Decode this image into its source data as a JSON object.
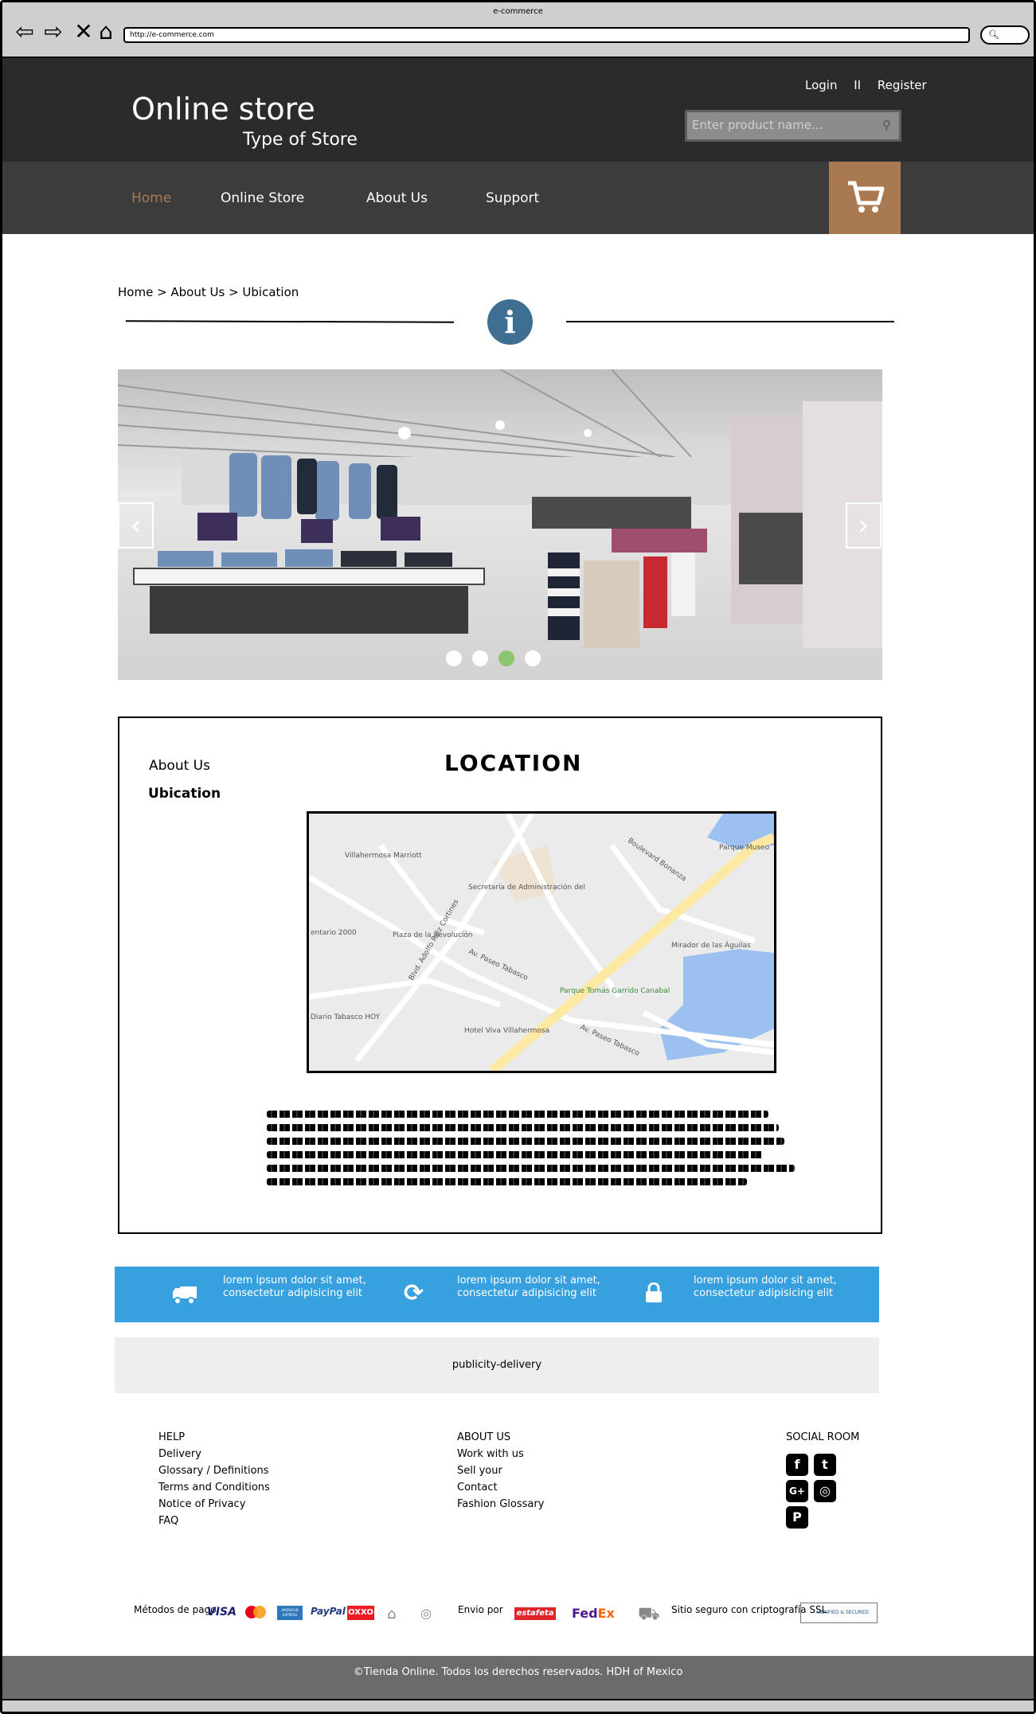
{
  "browser": {
    "window_title": "e-commerce",
    "url": "http://e-commerce.com"
  },
  "header": {
    "store_name": "Online store",
    "store_type": "Type of Store",
    "login": "Login",
    "separator": "II",
    "register": "Register",
    "search_placeholder": "Enter product name..."
  },
  "nav": {
    "items": [
      "Home",
      "Online Store",
      "About Us",
      "Support"
    ],
    "active": "Home"
  },
  "breadcrumb": "Home > About Us > Ubication",
  "carousel": {
    "dots": 4,
    "active_dot": 3
  },
  "location": {
    "side_items": [
      "About Us",
      "Ubication"
    ],
    "title": "LOCATION",
    "map_labels": [
      "Villahermosa Marriott",
      "Secretaría de Administración del",
      "Plaza de la Revolución",
      "Parque Tomás Garrido Canabal",
      "Hotel Viva Villahermosa",
      "Diario Tabasco HOY",
      "Mirador de las Águilas",
      "Parque Museo",
      "Av. Paseo Tabasco",
      "Blvd. Adolfo Ruiz Cortines",
      "Boulevard Bonanza",
      "Av. Paseo Tabasco",
      "entario 2000"
    ]
  },
  "features": [
    {
      "icon": "truck-icon",
      "text": "lorem ipsum dolor sit amet, consectetur adipisicing elit"
    },
    {
      "icon": "refresh-icon",
      "text": "lorem ipsum dolor sit amet, consectetur adipisicing elit"
    },
    {
      "icon": "lock-icon",
      "text": "lorem ipsum dolor sit amet, consectetur adipisicing elit"
    }
  ],
  "publicity": "publicity-delivery",
  "footer": {
    "help": {
      "title": "HELP",
      "links": [
        "Delivery",
        "Glossary / Definitions",
        "Terms and Conditions",
        "Notice of Privacy",
        "FAQ"
      ]
    },
    "about": {
      "title": "ABOUT US",
      "links": [
        "Work with us",
        "Sell your",
        "Contact",
        "Fashion Glossary"
      ]
    },
    "social_title": "SOCIAL ROOM"
  },
  "payment": {
    "methods_label": "Métodos de pago",
    "visa": "VISA",
    "amex": "AMERICAN EXPRESS",
    "paypal": "PayPal",
    "oxxo": "OXXO",
    "shipping_label": "Envio por",
    "estafeta": "estafeta",
    "fedex_fed": "Fed",
    "fedex_ex": "Ex",
    "ssl_label": "Sitio seguro con criptografía SSL",
    "ssl_badge": "VERIFIED & SECURED"
  },
  "copyright": "©Tienda Online. Todos los derechos reservados. HDH of Mexico",
  "colors": {
    "header_bg": "#2b2b2b",
    "nav_bg": "#3c3c3c",
    "accent": "#a97a52",
    "feature_bar": "#37a0df",
    "info_icon": "#3e6e92",
    "active_dot": "#8cc572"
  }
}
